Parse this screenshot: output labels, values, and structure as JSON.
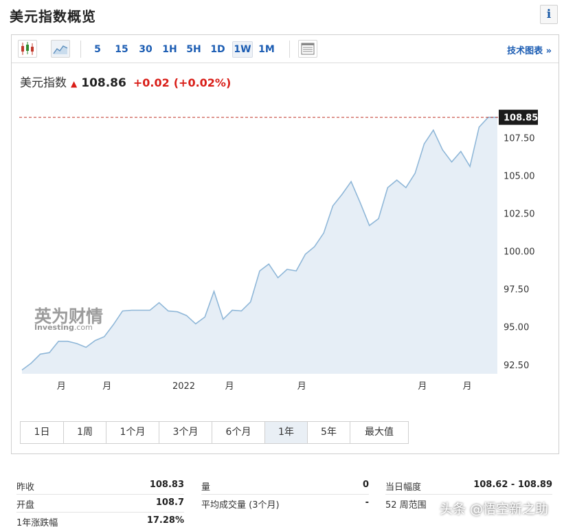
{
  "page": {
    "title": "美元指数概览",
    "info_label": "i"
  },
  "toolbar": {
    "periods": [
      "5",
      "15",
      "30",
      "1H",
      "5H",
      "1D",
      "1W",
      "1M"
    ],
    "active_period": "1W",
    "tech_chart_label": "技术图表 »"
  },
  "quote": {
    "name": "美元指数",
    "last": "108.86",
    "change": "+0.02",
    "change_pct": "(+0.02%)",
    "direction": "up"
  },
  "watermark_logo": {
    "cn": "英为财情",
    "en": "Investing",
    "suffix": ".com"
  },
  "chart_data": {
    "type": "area",
    "title": "",
    "xlabel": "",
    "ylabel": "",
    "ylim": [
      91.9,
      110.2
    ],
    "y_ticks": [
      92.5,
      95.0,
      97.5,
      100.0,
      102.5,
      105.0,
      107.5
    ],
    "y_tick_labels": [
      "92.50",
      "95.00",
      "97.50",
      "100.00",
      "102.50",
      "105.00",
      "107.50"
    ],
    "x_index_range": [
      0,
      52
    ],
    "x_ticks": [
      {
        "index": 4.3,
        "label": "月"
      },
      {
        "index": 9.3,
        "label": "月"
      },
      {
        "index": 17.7,
        "label": "2022"
      },
      {
        "index": 22.7,
        "label": "月"
      },
      {
        "index": 30.6,
        "label": "月"
      },
      {
        "index": 43.8,
        "label": "月"
      },
      {
        "index": 48.7,
        "label": "月"
      }
    ],
    "current_value": 108.85,
    "current_value_label": "108.85",
    "line_color": "#8fb7d8",
    "fill_color": "#e6eef6",
    "ref_line_color": "#c0392b",
    "series": [
      {
        "values": [
          92.15,
          92.6,
          93.2,
          93.3,
          94.05,
          94.05,
          93.9,
          93.65,
          94.1,
          94.35,
          95.15,
          96.05,
          96.1,
          96.1,
          96.1,
          96.6,
          96.05,
          96.0,
          95.75,
          95.2,
          95.65,
          97.35,
          95.5,
          96.1,
          96.05,
          96.65,
          98.7,
          99.15,
          98.25,
          98.8,
          98.7,
          99.8,
          100.3,
          101.2,
          103.0,
          103.75,
          104.6,
          103.2,
          101.7,
          102.15,
          104.2,
          104.7,
          104.2,
          105.15,
          107.1,
          108.0,
          106.7,
          105.9,
          106.6,
          105.6,
          108.2,
          108.85,
          108.85
        ]
      }
    ]
  },
  "range_tabs": [
    "1日",
    "1周",
    "1个月",
    "3个月",
    "6个月",
    "1年",
    "5年",
    "最大值"
  ],
  "active_range": "1年",
  "stats": [
    {
      "label": "昨收",
      "value": "108.83"
    },
    {
      "label": "开盘",
      "value": "108.7"
    },
    {
      "label": "1年涨跌幅",
      "value": "17.28%"
    },
    {
      "label": "量",
      "value": "0"
    },
    {
      "label": "平均成交量 (3个月)",
      "value": "-"
    },
    {
      "label": "当日幅度",
      "value": "108.62 - 108.89"
    },
    {
      "label": "52 周范围",
      "value": ""
    }
  ],
  "watermark": "头条 @悟空新之助"
}
